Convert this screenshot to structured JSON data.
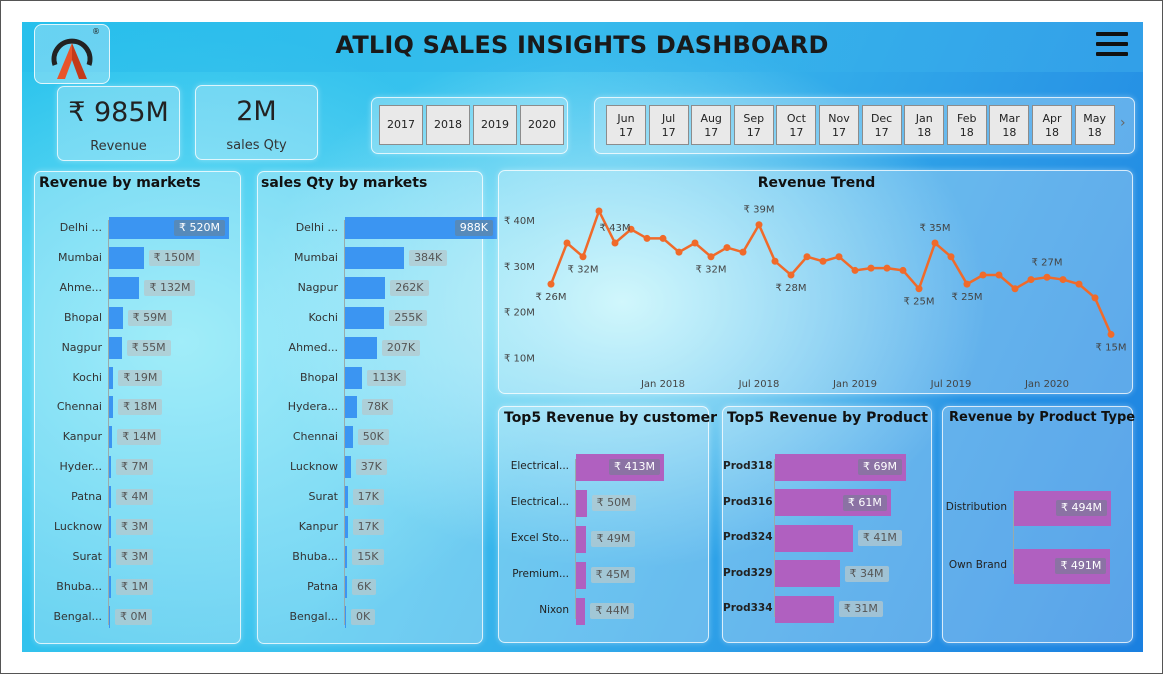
{
  "header": {
    "title": "ATLIQ SALES INSIGHTS DASHBOARD",
    "logo_mark": "®"
  },
  "kpis": [
    {
      "value": "₹ 985M",
      "label": "Revenue"
    },
    {
      "value": "2M",
      "label": "sales Qty"
    }
  ],
  "year_slicer": [
    "2017",
    "2018",
    "2019",
    "2020"
  ],
  "month_slicer": [
    [
      "Jun",
      "17"
    ],
    [
      "Jul",
      "17"
    ],
    [
      "Aug",
      "17"
    ],
    [
      "Sep",
      "17"
    ],
    [
      "Oct",
      "17"
    ],
    [
      "Nov",
      "17"
    ],
    [
      "Dec",
      "17"
    ],
    [
      "Jan",
      "18"
    ],
    [
      "Feb",
      "18"
    ],
    [
      "Mar",
      "18"
    ],
    [
      "Apr",
      "18"
    ],
    [
      "May",
      "18"
    ]
  ],
  "colors": {
    "market_bar": "#3b95f2",
    "customer_bar": "#b060c0",
    "trend_line": "#f06a2a"
  },
  "charts": {
    "revenue_markets": {
      "title": "Revenue by markets",
      "chart_data": {
        "type": "bar",
        "categories": [
          "Delhi ...",
          "Mumbai",
          "Ahme...",
          "Bhopal",
          "Nagpur",
          "Kochi",
          "Chennai",
          "Kanpur",
          "Hyder...",
          "Patna",
          "Lucknow",
          "Surat",
          "Bhuba...",
          "Bengal..."
        ],
        "values": [
          520,
          150,
          132,
          59,
          55,
          19,
          18,
          14,
          7,
          4,
          3,
          3,
          1,
          0
        ],
        "labels": [
          "₹ 520M",
          "₹ 150M",
          "₹ 132M",
          "₹ 59M",
          "₹ 55M",
          "₹ 19M",
          "₹ 18M",
          "₹ 14M",
          "₹ 7M",
          "₹ 4M",
          "₹ 3M",
          "₹ 3M",
          "₹ 1M",
          "₹ 0M"
        ]
      }
    },
    "qty_markets": {
      "title": "sales Qty by markets",
      "chart_data": {
        "type": "bar",
        "categories": [
          "Delhi ...",
          "Mumbai",
          "Nagpur",
          "Kochi",
          "Ahmed...",
          "Bhopal",
          "Hydera...",
          "Chennai",
          "Lucknow",
          "Surat",
          "Kanpur",
          "Bhuba...",
          "Patna",
          "Bengal..."
        ],
        "values": [
          988,
          384,
          262,
          255,
          207,
          113,
          78,
          50,
          37,
          17,
          17,
          15,
          6,
          0
        ],
        "labels": [
          "988K",
          "384K",
          "262K",
          "255K",
          "207K",
          "113K",
          "78K",
          "50K",
          "37K",
          "17K",
          "17K",
          "15K",
          "6K",
          "0K"
        ]
      }
    },
    "revenue_trend": {
      "title": "Revenue Trend",
      "chart_data": {
        "type": "line",
        "y_ticks": [
          "₹ 40M",
          "₹ 30M",
          "₹ 20M",
          "₹ 10M"
        ],
        "y_tick_values": [
          40,
          30,
          20,
          10
        ],
        "x_ticks": [
          "Jan 2018",
          "Jul 2018",
          "Jan 2019",
          "Jul 2019",
          "Jan 2020"
        ],
        "x_tick_index": [
          7,
          13,
          19,
          25,
          31
        ],
        "ylim": [
          7,
          42
        ],
        "values": [
          26,
          35,
          32,
          42,
          35,
          38,
          36,
          36,
          33,
          35,
          32,
          34,
          33,
          39,
          31,
          28,
          32,
          31,
          32,
          29,
          29.5,
          29.5,
          29,
          25,
          35,
          32,
          26,
          28,
          28,
          25,
          27,
          27.5,
          27,
          26,
          23,
          15
        ],
        "point_labels": [
          {
            "i": 0,
            "text": "₹ 26M"
          },
          {
            "i": 2,
            "text": "₹ 32M"
          },
          {
            "i": 4,
            "text": "₹ 43M"
          },
          {
            "i": 10,
            "text": "₹ 32M"
          },
          {
            "i": 13,
            "text": "₹ 39M"
          },
          {
            "i": 15,
            "text": "₹ 28M"
          },
          {
            "i": 23,
            "text": "₹ 25M"
          },
          {
            "i": 24,
            "text": "₹ 35M"
          },
          {
            "i": 26,
            "text": "₹ 25M"
          },
          {
            "i": 31,
            "text": "₹ 27M"
          },
          {
            "i": 35,
            "text": "₹ 15M"
          }
        ]
      }
    },
    "top_customers": {
      "title": "Top5 Revenue by customer",
      "chart_data": {
        "type": "bar",
        "categories": [
          "Electrical...",
          "Electrical...",
          "Excel Sto...",
          "Premium...",
          "Nixon"
        ],
        "values": [
          413,
          50,
          49,
          45,
          44
        ],
        "labels": [
          "₹ 413M",
          "₹ 50M",
          "₹ 49M",
          "₹ 45M",
          "₹ 44M"
        ]
      }
    },
    "top_products": {
      "title": "Top5 Revenue by Product",
      "chart_data": {
        "type": "bar",
        "categories": [
          "Prod318",
          "Prod316",
          "Prod324",
          "Prod329",
          "Prod334"
        ],
        "values": [
          69,
          61,
          41,
          34,
          31
        ],
        "labels": [
          "₹ 69M",
          "₹ 61M",
          "₹ 41M",
          "₹ 34M",
          "₹ 31M"
        ]
      }
    },
    "product_type": {
      "title": "Revenue by Product Type",
      "chart_data": {
        "type": "bar",
        "categories": [
          "Distribution",
          "Own Brand"
        ],
        "values": [
          494,
          491
        ],
        "labels": [
          "₹ 494M",
          "₹ 491M"
        ]
      }
    }
  }
}
